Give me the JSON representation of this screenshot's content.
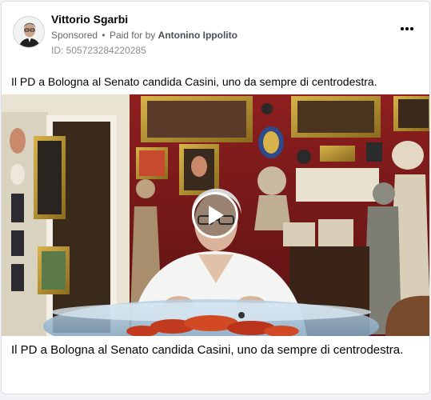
{
  "post": {
    "author_name": "Vittorio Sgarbi",
    "sponsored_label": "Sponsored",
    "separator": "•",
    "paid_prefix": "Paid for by",
    "payer_name": "Antonino Ippolito",
    "ad_id": "ID: 505723284220285",
    "caption": "Il PD a Bologna al Senato candida Casini, uno da sempre di centrodestra.",
    "video_title": "Il PD a Bologna al Senato candida Casini, uno da sempre di centrodestra."
  },
  "icons": {
    "more": "more-options-icon",
    "play": "play-icon"
  }
}
